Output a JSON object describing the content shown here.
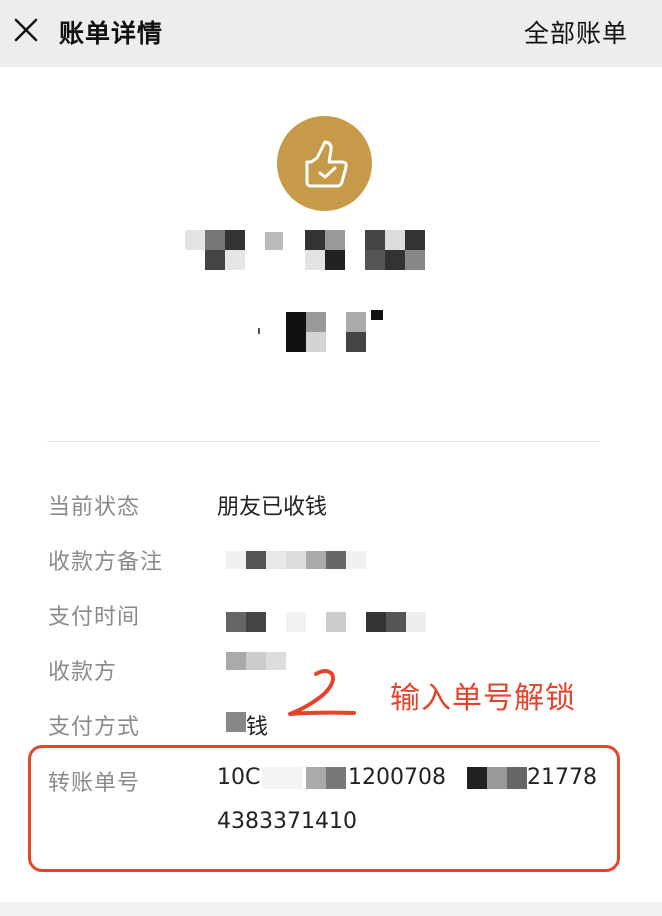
{
  "header": {
    "title": "账单详情",
    "all_bills_label": "全部账单",
    "close_icon": "close-icon"
  },
  "avatar": {
    "icon": "thumbs-up-icon",
    "color": "#c69a49"
  },
  "details": {
    "rows": [
      {
        "label": "当前状态",
        "value": "朋友已收钱"
      },
      {
        "label": "收款方备注",
        "value": ""
      },
      {
        "label": "支付时间",
        "value": ""
      },
      {
        "label": "收款方",
        "value": ""
      },
      {
        "label": "支付方式",
        "value": "钱"
      },
      {
        "label": "转账单号",
        "value_line1": "10C",
        "value_line1_mid": "1200708",
        "value_line1_end": "21778",
        "value_line2": "4383371410"
      }
    ]
  },
  "annotation": {
    "mark": "2",
    "text": "输入单号解锁",
    "color": "#e5442b"
  }
}
